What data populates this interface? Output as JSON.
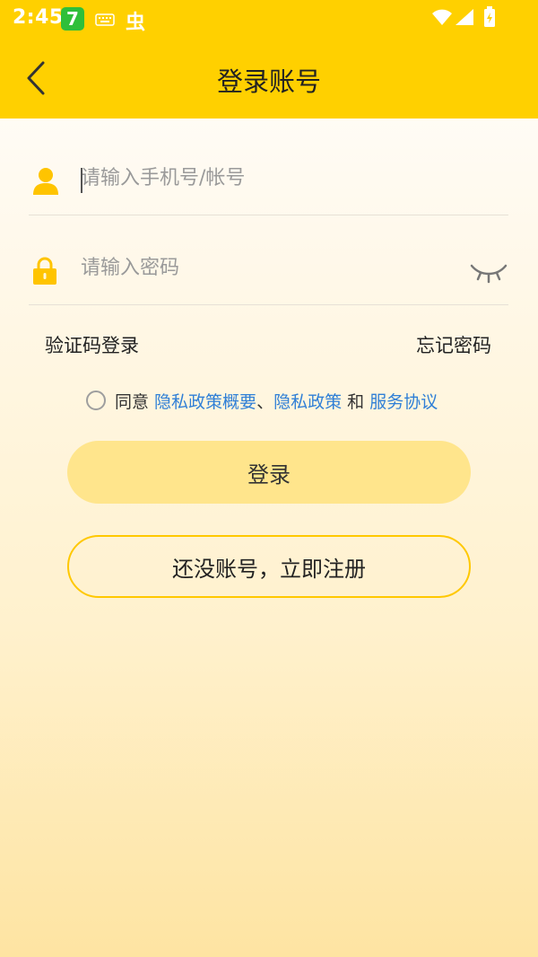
{
  "status_bar": {
    "time": "2:45",
    "app_badge": "7",
    "bug_glyph": "虫"
  },
  "header": {
    "title": "登录账号"
  },
  "form": {
    "account_placeholder": "请输入手机号/帐号",
    "password_placeholder": "请输入密码"
  },
  "links": {
    "sms_login": "验证码登录",
    "forgot_password": "忘记密码"
  },
  "agreement": {
    "prefix": "同意 ",
    "privacy_summary": "隐私政策概要",
    "separator": "、",
    "privacy_policy": "隐私政策",
    "and": " 和 ",
    "service_agreement": "服务协议"
  },
  "buttons": {
    "login": "登录",
    "register": "还没账号，立即注册"
  },
  "colors": {
    "brand_yellow": "#FFD000",
    "login_button": "#FFE58C",
    "register_border": "#FFC800",
    "link_blue": "#2F7FD6",
    "icon_yellow": "#FFC400"
  },
  "icons": {
    "back": "chevron-left-icon",
    "account": "user-icon",
    "password": "lock-icon",
    "visibility": "eye-closed-icon"
  }
}
